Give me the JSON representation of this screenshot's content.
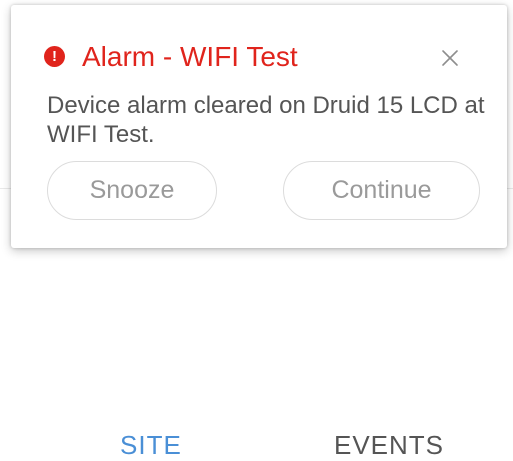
{
  "dialog": {
    "title": "Alarm - WIFI Test",
    "alert_icon_glyph": "!",
    "message": "Device alarm cleared on Druid 15 LCD at WIFI Test.",
    "snooze_label": "Snooze",
    "continue_label": "Continue",
    "close_icon": "close-icon",
    "alert_icon": "alert-circle-icon"
  },
  "background_tabs": {
    "site_label": "SITE",
    "events_label": "EVENTS"
  },
  "colors": {
    "title": "#e0241c",
    "alert_icon": "#e0241c",
    "button_text": "#9a9a9a",
    "site_tab": "#4a8fd6"
  }
}
